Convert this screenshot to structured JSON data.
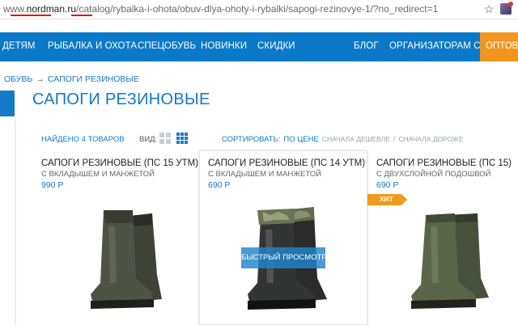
{
  "browser": {
    "url_prefix": "www.",
    "url_domain": "nordman.ru",
    "url_path": "/catalog/rybalka-i-ohota/obuv-dlya-ohoty-i-rybalki/sapogi-rezinovye-1/?no_redirect=1"
  },
  "nav": {
    "items": [
      "ДЕТЯМ",
      "РЫБАЛКА И ОХОТА",
      "СПЕЦОБУВЬ",
      "НОВИНКИ",
      "СКИДКИ",
      "БЛОГ",
      "ОРГАНИЗАТОРАМ СП"
    ],
    "wholesale": "ОПТОВ"
  },
  "breadcrumb": {
    "parent": "ОБУВЬ",
    "separator": "→",
    "current": "САПОГИ РЕЗИНОВЫЕ"
  },
  "page": {
    "title": "САПОГИ РЕЗИНОВЫЕ"
  },
  "toolbar": {
    "found": "НАЙДЕНО 4 ТОВАРОВ",
    "view_label": "ВИД:",
    "sort_label": "СОРТИРОВАТЬ:",
    "sort_by": "ПО ЦЕНЕ",
    "sort_cheaper": "СНАЧАЛА ДЕШЕВЛЕ",
    "sort_sep": "/",
    "sort_dearer": "СНАЧАЛА ДОРОЖЕ"
  },
  "products": [
    {
      "title": "САПОГИ РЕЗИНОВЫЕ (ПС 15 УТМ)",
      "subtitle": "С ВКЛАДЫШЕМ И МАНЖЕТОЙ",
      "price": "990 Р"
    },
    {
      "title": "САПОГИ РЕЗИНОВЫЕ (ПС 14 УТМ)",
      "subtitle": "С ВКЛАДЫШЕМ И МАНЖЕТОЙ",
      "price": "690 Р",
      "quick_view": "БЫСТРЫЙ ПРОСМОТР"
    },
    {
      "title": "САПОГИ РЕЗИНОВЫЕ (ПС 15)",
      "subtitle": "С ДВУХСЛОЙНОЙ ПОДОШВОЙ",
      "price": "690 Р",
      "badge": "ХИТ"
    }
  ],
  "colors": {
    "brand_blue": "#0a79c8",
    "accent_orange": "#f0961e",
    "underline_red": "#d21b1b"
  },
  "icons": [
    "star-icon",
    "extension-icon",
    "grid-large-icon",
    "grid-small-icon"
  ]
}
